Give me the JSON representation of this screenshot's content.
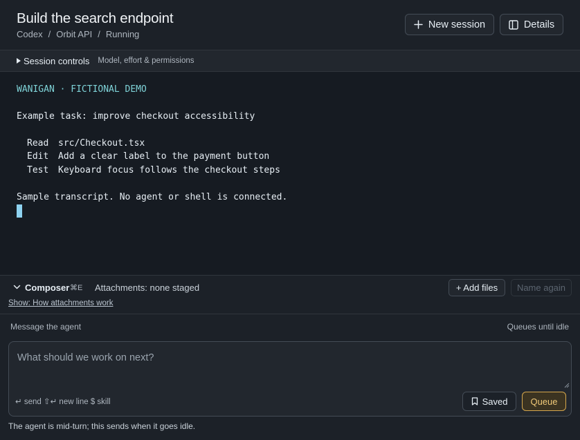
{
  "header": {
    "title": "Build the search endpoint",
    "breadcrumb": [
      "Codex",
      "Orbit API",
      "Running"
    ],
    "new_session_label": "New session",
    "details_label": "Details"
  },
  "session_controls": {
    "label": "Session controls",
    "subtitle": "Model, effort & permissions"
  },
  "terminal": {
    "banner": "WANIGAN · FICTIONAL DEMO",
    "task": "Example task: improve checkout accessibility",
    "steps": [
      {
        "verb": "Read",
        "text": "src/Checkout.tsx"
      },
      {
        "verb": "Edit",
        "text": "Add a clear label to the payment button"
      },
      {
        "verb": "Test",
        "text": "Keyboard focus follows the checkout steps"
      }
    ],
    "footer": "Sample transcript. No agent or shell is connected."
  },
  "composer": {
    "label": "Composer",
    "shortcut": "⌘E",
    "attachments": "Attachments: none staged",
    "show_link": "Show: How attachments work",
    "add_files_label": "+ Add files",
    "name_again_label": "Name again",
    "message_label": "Message the agent",
    "queue_note": "Queues until idle",
    "placeholder": "What should we work on next?",
    "hints": "↵ send  ⇧↵ new line  $ skill",
    "saved_label": "Saved",
    "queue_label": "Queue",
    "status_note": "The agent is mid-turn; this sends when it goes idle."
  },
  "colors": {
    "accent_teal": "#7fd3d8",
    "queue_gold": "#f0c978",
    "cursor": "#8ed2f0"
  }
}
